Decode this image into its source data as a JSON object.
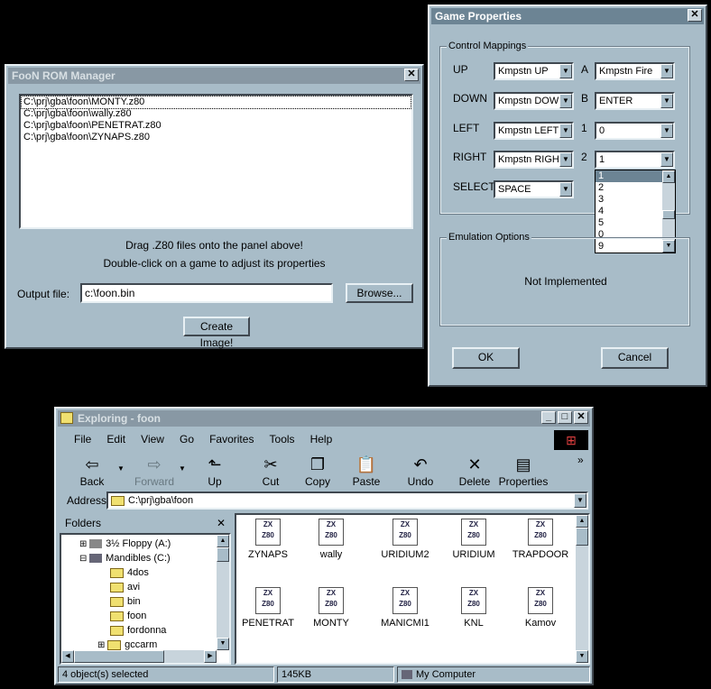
{
  "rom_manager": {
    "title": "FooN ROM Manager",
    "files": [
      "C:\\prj\\gba\\foon\\MONTY.z80",
      "C:\\prj\\gba\\foon\\wally.z80",
      "C:\\prj\\gba\\foon\\PENETRAT.z80",
      "C:\\prj\\gba\\foon\\ZYNAPS.z80"
    ],
    "hint1": "Drag .Z80 files onto the panel above!",
    "hint2": "Double-click on a game to adjust its properties",
    "output_label": "Output file:",
    "output_value": "c:\\foon.bin",
    "browse_label": "Browse...",
    "create_label": "Create Image!"
  },
  "game_props": {
    "title": "Game Properties",
    "control_group": "Control Mappings",
    "up_label": "UP",
    "up_value": "Kmpstn UP",
    "down_label": "DOWN",
    "down_value": "Kmpstn DOWN",
    "left_label": "LEFT",
    "left_value": "Kmpstn LEFT",
    "right_label": "RIGHT",
    "right_value": "Kmpstn RIGHT",
    "select_label": "SELECT",
    "select_value": "SPACE",
    "a_label": "A",
    "a_value": "Kmpstn Fire",
    "b_label": "B",
    "b_value": "ENTER",
    "one_label": "1",
    "one_value": "0",
    "two_label": "2",
    "two_value": "1",
    "dropdown_options": [
      "1",
      "2",
      "3",
      "4",
      "5",
      "0",
      "9"
    ],
    "emulation_group": "Emulation Options",
    "not_impl": "Not Implemented",
    "ok_label": "OK",
    "cancel_label": "Cancel"
  },
  "explorer": {
    "title": "Exploring - foon",
    "menu": [
      "File",
      "Edit",
      "View",
      "Go",
      "Favorites",
      "Tools",
      "Help"
    ],
    "toolbar": {
      "back": "Back",
      "forward": "Forward",
      "up": "Up",
      "cut": "Cut",
      "copy": "Copy",
      "paste": "Paste",
      "undo": "Undo",
      "delete": "Delete",
      "properties": "Properties"
    },
    "address_label": "Address",
    "address_value": "C:\\prj\\gba\\foon",
    "folders_label": "Folders",
    "tree": {
      "floppy": "3½ Floppy (A:)",
      "drive": "Mandibles (C:)",
      "f1": "4dos",
      "f2": "avi",
      "f3": "bin",
      "f4": "foon",
      "f5": "fordonna",
      "f6": "gccarm"
    },
    "files_row1": [
      "ZYNAPS",
      "wally",
      "URIDIUM2",
      "URIDIUM",
      "TRAPDOOR"
    ],
    "files_row2": [
      "PENETRAT",
      "MONTY",
      "MANICMI1",
      "KNL",
      "Kamov"
    ],
    "icon_text1": "ZX",
    "icon_text2": "Z80",
    "status_selected": "4 object(s) selected",
    "status_size": "145KB",
    "status_location": "My Computer"
  }
}
